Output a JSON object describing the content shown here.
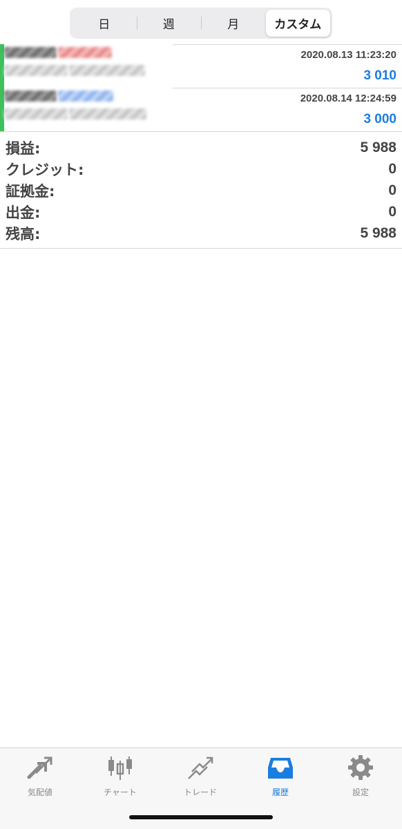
{
  "segmented": {
    "options": [
      "日",
      "週",
      "月",
      "カスタム"
    ],
    "selected": "カスタム"
  },
  "deals": [
    {
      "time": "2020.08.13 11:23:20",
      "profit": "3 010",
      "side_color": "#3cc25a",
      "tag_color": "#e98a8a"
    },
    {
      "time": "2020.08.14 12:24:59",
      "profit": "3 000",
      "side_color": "#3cc25a",
      "tag_color": "#8fb4ee"
    }
  ],
  "summary": [
    {
      "label": "損益:",
      "value": "5 988"
    },
    {
      "label": "クレジット:",
      "value": "0"
    },
    {
      "label": "証拠金:",
      "value": "0"
    },
    {
      "label": "出金:",
      "value": "0"
    },
    {
      "label": "残高:",
      "value": "5 988"
    }
  ],
  "tabbar": {
    "tabs": [
      {
        "label": "気配値",
        "icon": "quotes-arrows-icon"
      },
      {
        "label": "チャート",
        "icon": "candlestick-chart-icon"
      },
      {
        "label": "トレード",
        "icon": "trade-trend-icon"
      },
      {
        "label": "履歴",
        "icon": "history-inbox-icon"
      },
      {
        "label": "設定",
        "icon": "gear-icon"
      }
    ],
    "active": "履歴",
    "accent_color": "#1a7de0",
    "inactive_color": "#8a8a8a"
  }
}
